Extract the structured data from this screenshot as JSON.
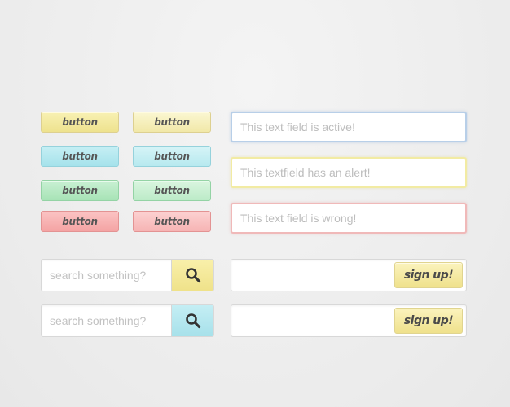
{
  "header": {
    "title": ""
  },
  "buttons": {
    "rows": [
      {
        "color": "yellow",
        "left_label": "button",
        "right_label": "button"
      },
      {
        "color": "cyan",
        "left_label": "button",
        "right_label": "button"
      },
      {
        "color": "green",
        "left_label": "button",
        "right_label": "button"
      },
      {
        "color": "red",
        "left_label": "button",
        "right_label": "button"
      }
    ]
  },
  "textfields": {
    "active": {
      "placeholder": "This text field is active!",
      "border_color": "#b8cfe8"
    },
    "alert": {
      "placeholder": "This textfield has an alert!",
      "border_color": "#f2eba3"
    },
    "wrong": {
      "placeholder": "This text field is wrong!",
      "border_color": "#f0b9b9"
    }
  },
  "search": [
    {
      "placeholder": "search something?",
      "icon": "search-icon",
      "accent": "#f2e696"
    },
    {
      "placeholder": "search something?",
      "icon": "search-icon",
      "accent": "#b3e6ee"
    }
  ],
  "signup": [
    {
      "button_label": "sign up!",
      "value": ""
    },
    {
      "button_label": "sign up!",
      "value": ""
    }
  ],
  "colors": {
    "yellow": "#f2e696",
    "cyan": "#b3e6ee",
    "green": "#b5e8c2",
    "red": "#f6b0b0",
    "background": "#efefef"
  }
}
